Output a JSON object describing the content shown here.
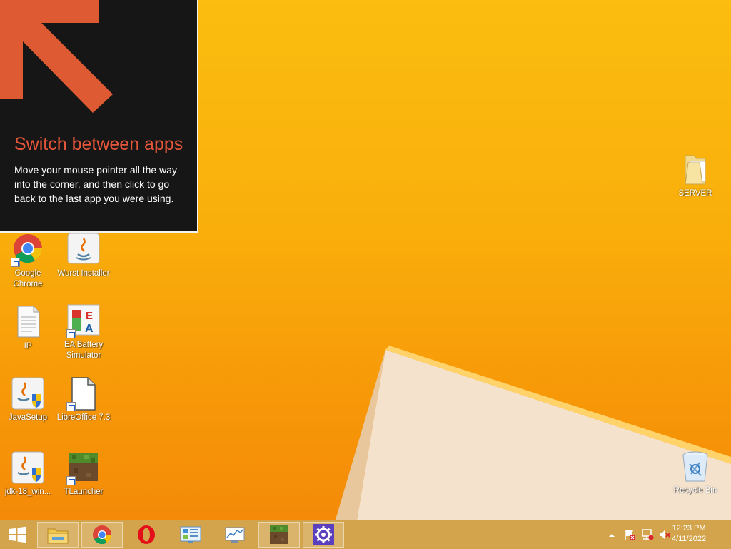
{
  "tip": {
    "title": "Switch between apps",
    "body": "Move your mouse pointer all the way into the corner, and then click to go back to the last app you were using."
  },
  "desktop_icons": [
    {
      "label": "Google Chrome",
      "icon": "chrome-icon"
    },
    {
      "label": "Wurst Installer",
      "icon": "java-icon"
    },
    {
      "label": "IP",
      "icon": "text-file-icon"
    },
    {
      "label": "EA Battery Simulator",
      "icon": "ea-battery-icon"
    },
    {
      "label": "JavaSetup",
      "icon": "java-setup-icon"
    },
    {
      "label": "LibreOffice 7.3",
      "icon": "libreoffice-icon"
    },
    {
      "label": "jdk-18_win...",
      "icon": "java-setup-icon"
    },
    {
      "label": "TLauncher",
      "icon": "minecraft-grass-icon"
    },
    {
      "label": "SERVER",
      "icon": "folder-icon"
    },
    {
      "label": "Recycle Bin",
      "icon": "recycle-bin-icon"
    }
  ],
  "taskbar": {
    "apps": [
      {
        "name": "start",
        "icon": "windows-logo-icon"
      },
      {
        "name": "file-explorer",
        "icon": "folder-icon"
      },
      {
        "name": "chrome",
        "icon": "chrome-icon"
      },
      {
        "name": "opera",
        "icon": "opera-icon"
      },
      {
        "name": "control-panel",
        "icon": "control-panel-icon"
      },
      {
        "name": "system-monitor",
        "icon": "monitor-icon"
      },
      {
        "name": "minecraft",
        "icon": "minecraft-grass-icon"
      },
      {
        "name": "settings",
        "icon": "gear-icon"
      }
    ],
    "time": "12:23 PM",
    "date": "4/11/2022"
  },
  "colors": {
    "tip_title": "#e5563a",
    "arrow": "#dd5a33",
    "desktop_bg": "#f9ae0b"
  }
}
